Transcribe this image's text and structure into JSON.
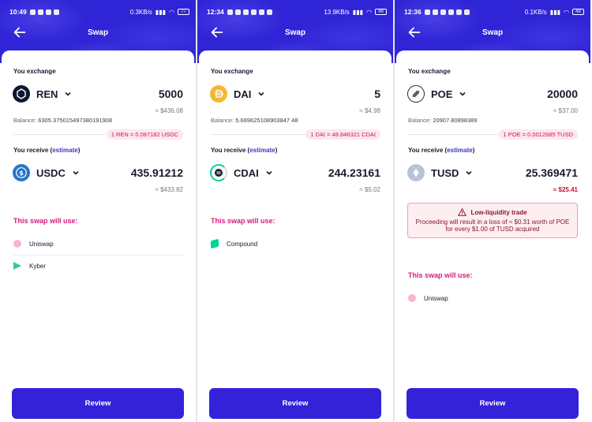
{
  "screens": [
    {
      "status": {
        "time": "10:49",
        "net": "0.3KB/s",
        "battery": "77"
      },
      "header": {
        "title": "Swap"
      },
      "exchange": {
        "label": "You exchange",
        "token": "REN",
        "amount": "5000",
        "usd": "≈ $436.08",
        "balance_label": "Balance:",
        "balance": "6305.375015497380191908"
      },
      "rate": "1 REN = 0.087182 USDC",
      "receive": {
        "label_pre": "You receive (",
        "label_link": "estimate",
        "label_post": ")",
        "token": "USDC",
        "amount": "435.91212",
        "usd": "≈ $433.82"
      },
      "uses_title": "This swap will use:",
      "sources": [
        "Uniswap",
        "Kyber"
      ],
      "review": "Review"
    },
    {
      "status": {
        "time": "12:34",
        "net": "13.9KB/s",
        "battery": "48"
      },
      "header": {
        "title": "Swap"
      },
      "exchange": {
        "label": "You exchange",
        "token": "DAI",
        "amount": "5",
        "usd": "≈ $4.98",
        "balance_label": "Balance:",
        "balance": "5.669625108903847 48"
      },
      "rate": "1 DAI = 48.846321 CDAI",
      "receive": {
        "label_pre": "You receive (",
        "label_link": "estimate",
        "label_post": ")",
        "token": "CDAI",
        "amount": "244.23161",
        "usd": "≈ $5.02"
      },
      "uses_title": "This swap will use:",
      "sources": [
        "Compound"
      ],
      "review": "Review"
    },
    {
      "status": {
        "time": "12:36",
        "net": "0.1KB/s",
        "battery": "48"
      },
      "header": {
        "title": "Swap"
      },
      "exchange": {
        "label": "You exchange",
        "token": "POE",
        "amount": "20000",
        "usd": "≈ $37.00",
        "balance_label": "Balance:",
        "balance": "20907.80898389"
      },
      "rate": "1 POE = 0.0012685 TUSD",
      "receive": {
        "label_pre": "You receive (",
        "label_link": "estimate",
        "label_post": ")",
        "token": "TUSD",
        "amount": "25.369471",
        "usd": "≈ $25.41"
      },
      "warning": {
        "title": "Low-liquidity trade",
        "text": "Proceeding will result in a loss of ≈ $0.31 worth of POE for every $1.00 of TUSD acquired"
      },
      "uses_title": "This swap will use:",
      "sources": [
        "Uniswap"
      ],
      "review": "Review"
    }
  ],
  "colors": {
    "brand": "#2f25d6",
    "accent": "#d6197d",
    "button": "#3422d9",
    "warning": "#c8102e"
  },
  "icons": {
    "tokens": [
      "ren-icon",
      "usdc-icon",
      "dai-icon",
      "cdai-icon",
      "poe-icon",
      "tusd-icon"
    ],
    "sources": [
      "uniswap-icon",
      "kyber-icon",
      "compound-icon"
    ]
  }
}
